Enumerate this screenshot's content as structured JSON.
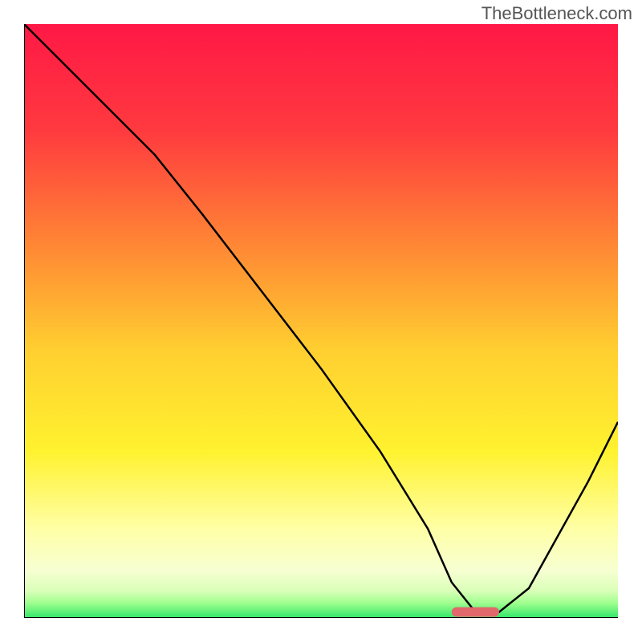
{
  "watermark": "TheBottleneck.com",
  "chart_data": {
    "type": "line",
    "title": "",
    "xlabel": "",
    "ylabel": "",
    "xlim": [
      0,
      100
    ],
    "ylim": [
      0,
      100
    ],
    "gradient": {
      "description": "vertical gradient from red at top through orange/yellow to pale-yellow and thin green at bottom",
      "stops": [
        {
          "offset": 0.0,
          "color": "#ff1846"
        },
        {
          "offset": 0.18,
          "color": "#ff3a3f"
        },
        {
          "offset": 0.38,
          "color": "#ff8a34"
        },
        {
          "offset": 0.55,
          "color": "#ffcf30"
        },
        {
          "offset": 0.72,
          "color": "#fff22f"
        },
        {
          "offset": 0.85,
          "color": "#ffffa6"
        },
        {
          "offset": 0.92,
          "color": "#f7ffd2"
        },
        {
          "offset": 0.955,
          "color": "#d9ffb8"
        },
        {
          "offset": 0.975,
          "color": "#9fff8e"
        },
        {
          "offset": 1.0,
          "color": "#32e66a"
        }
      ]
    },
    "series": [
      {
        "name": "bottleneck-curve",
        "x": [
          0,
          10,
          22,
          30,
          40,
          50,
          60,
          68,
          72,
          76,
          80,
          85,
          90,
          95,
          100
        ],
        "y": [
          100,
          90,
          78,
          68,
          55,
          42,
          28,
          15,
          6,
          1,
          1,
          5,
          14,
          23,
          33
        ]
      }
    ],
    "marker": {
      "name": "optimal-range",
      "x_start": 72,
      "x_end": 80,
      "y": 1,
      "color": "#e1686b"
    }
  }
}
